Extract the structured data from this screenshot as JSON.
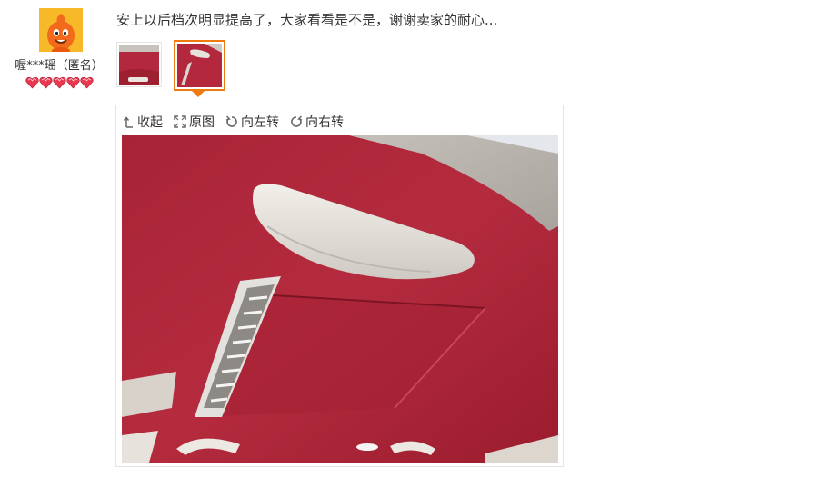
{
  "reviewer": {
    "username": "喔***瑶（匿名）",
    "avatar_icon": "taobao-mascot-avatar-icon",
    "credit_icon": "red-heart-gem-icon",
    "credit_count": 5
  },
  "review": {
    "text": "安上以后档次明显提高了，大家看看是不是，谢谢卖家的耐心..."
  },
  "thumbnails": [
    {
      "name": "photo-thumbnail-1",
      "selected": false
    },
    {
      "name": "photo-thumbnail-2",
      "selected": true
    }
  ],
  "viewer": {
    "collapse_label": "收起",
    "original_label": "原图",
    "rotate_left_label": "向左转",
    "rotate_right_label": "向右转"
  },
  "colors": {
    "accent": "#f07a12",
    "headliner_red": "#b3283c",
    "avatar_orange": "#f7a21b"
  }
}
